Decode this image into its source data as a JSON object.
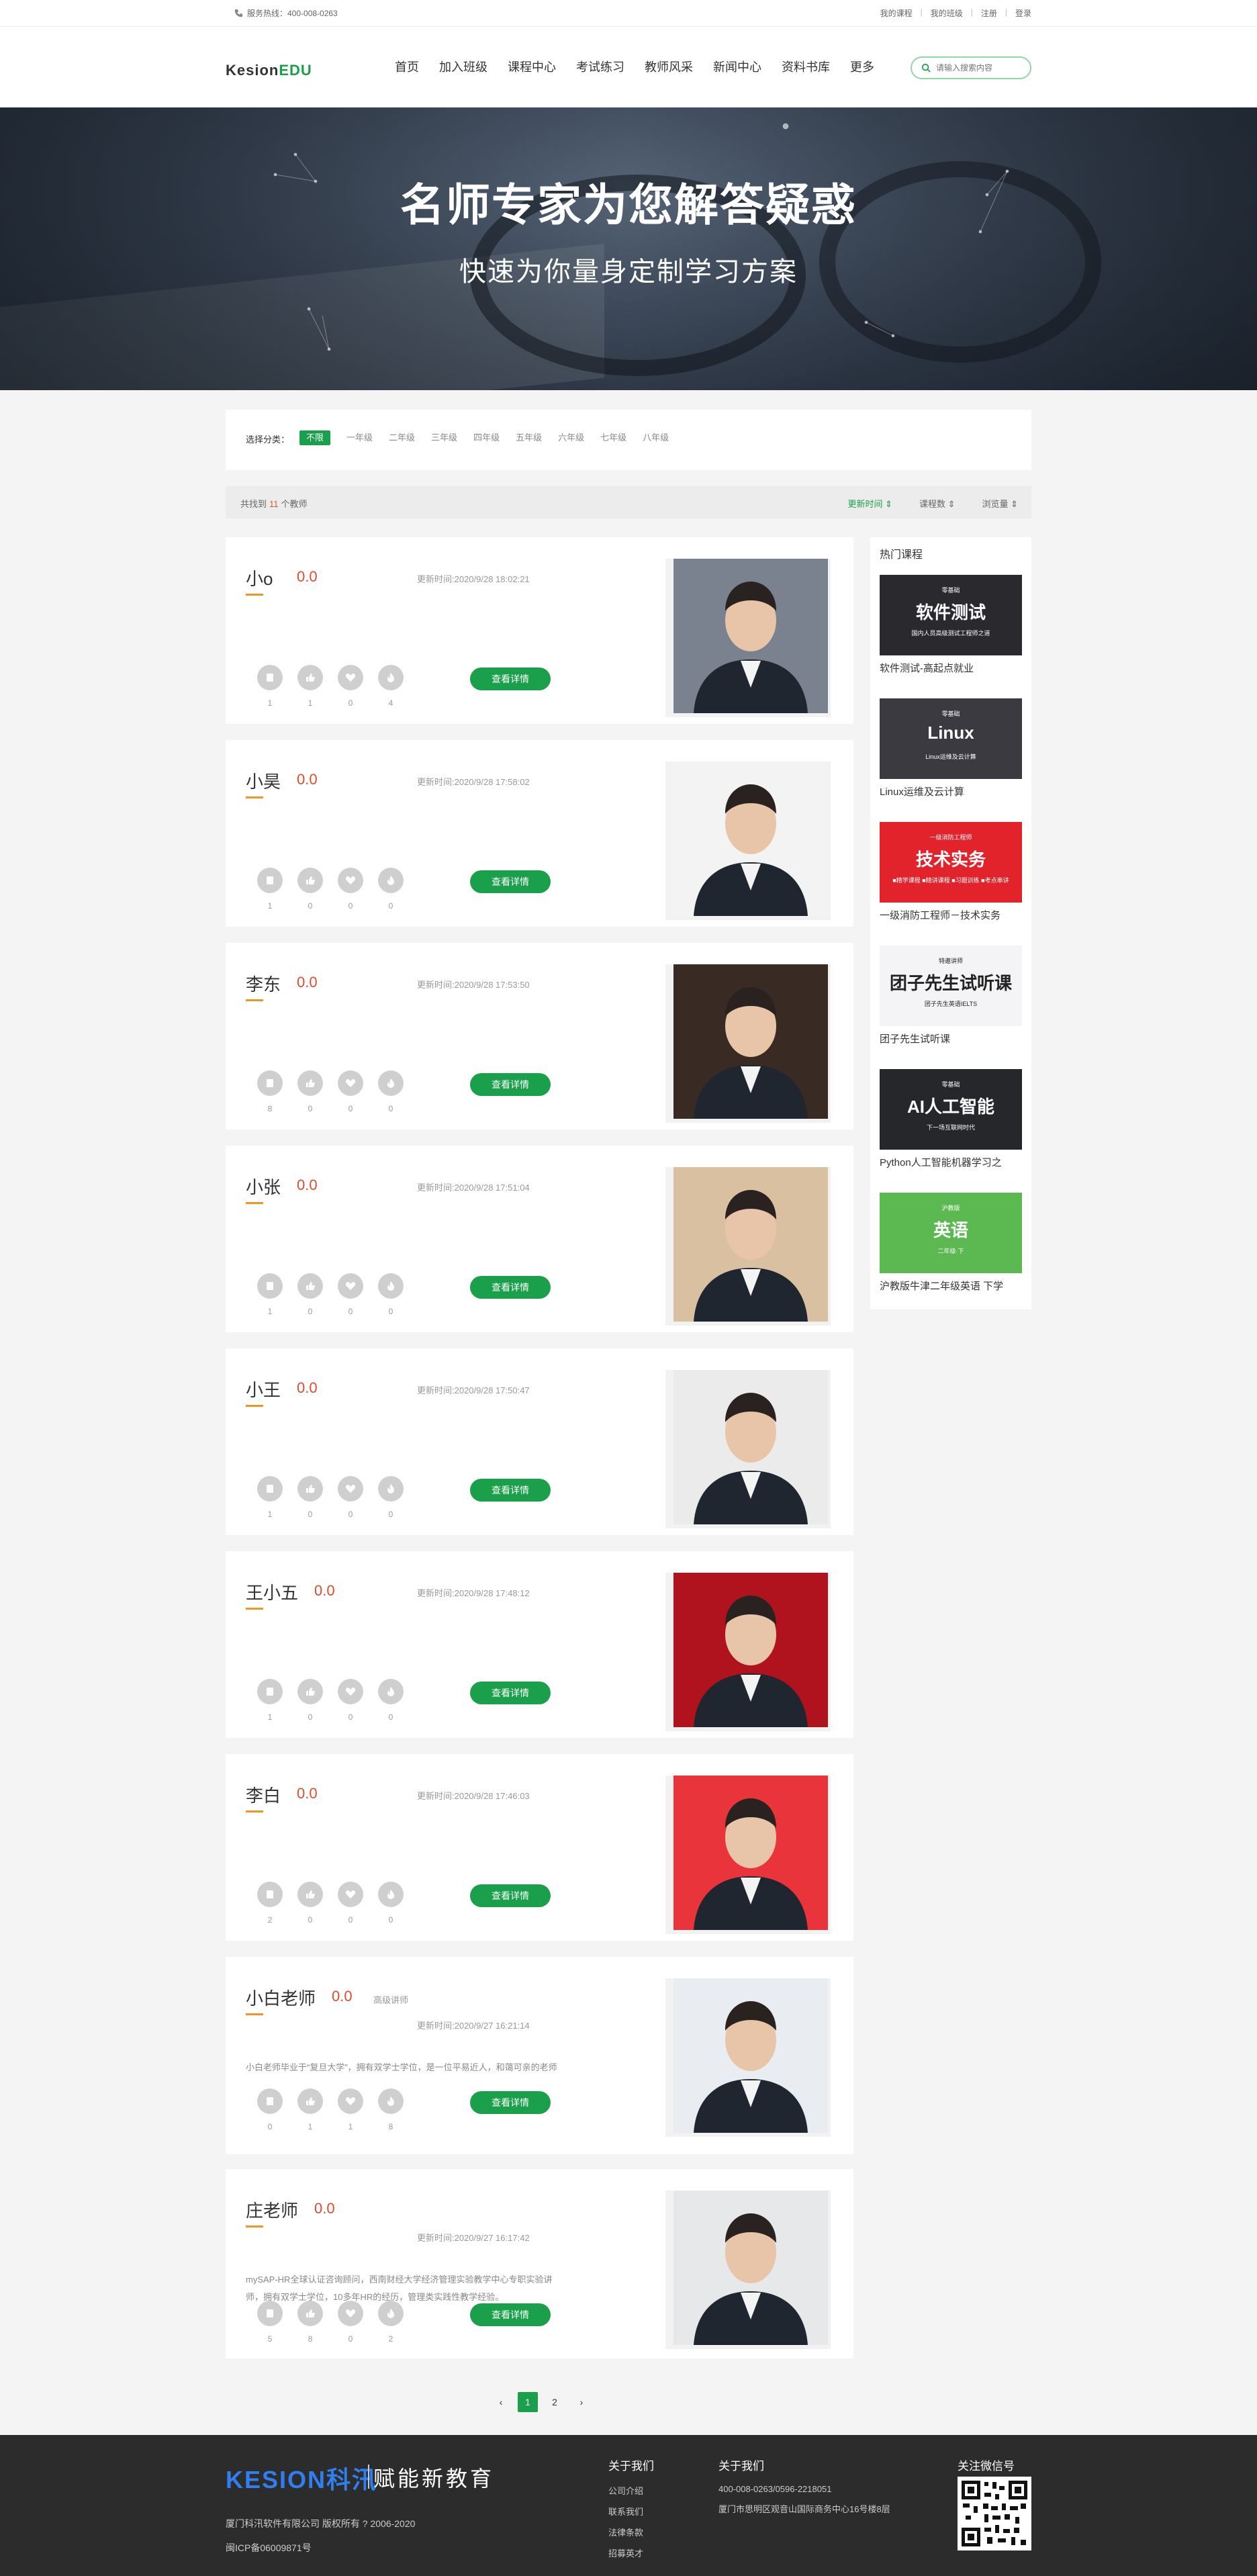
{
  "topbar": {
    "hotline": "服务热线：400-008-0263",
    "links": [
      "我的课程",
      "我的班级",
      "注册",
      "登录"
    ]
  },
  "header": {
    "logo_main": "Kesion",
    "logo_edu": "EDU",
    "nav": [
      "首页",
      "加入班级",
      "课程中心",
      "考试练习",
      "教师风采",
      "新闻中心",
      "资料书库",
      "更多"
    ],
    "search_placeholder": "请输入搜索内容"
  },
  "banner": {
    "title": "名师专家为您解答疑惑",
    "subtitle": "快速为你量身定制学习方案"
  },
  "filter": {
    "label": "选择分类：",
    "options": [
      "不限",
      "一年级",
      "二年级",
      "三年级",
      "四年级",
      "五年级",
      "六年级",
      "七年级",
      "八年级"
    ],
    "active": "不限"
  },
  "sortbar": {
    "prefix": "共找到",
    "count": "11",
    "suffix": "个教师",
    "sorts": [
      "更新时间 ⇕",
      "课程数 ⇕",
      "浏览量 ⇕"
    ]
  },
  "teachers": [
    {
      "name": "小o",
      "score": "0.0",
      "role": "",
      "time": "更新时间:2020/9/28 18:02:21",
      "intro": "",
      "stats": [
        "1",
        "1",
        "0",
        "4"
      ],
      "button": "查看详情",
      "photo_bg": "#7a8290"
    },
    {
      "name": "小昊",
      "score": "0.0",
      "role": "",
      "time": "更新时间:2020/9/28 17:58:02",
      "intro": "",
      "stats": [
        "1",
        "0",
        "0",
        "0"
      ],
      "button": "查看详情",
      "photo_bg": "#f3f3f3"
    },
    {
      "name": "李东",
      "score": "0.0",
      "role": "",
      "time": "更新时间:2020/9/28 17:53:50",
      "intro": "",
      "stats": [
        "8",
        "0",
        "0",
        "0"
      ],
      "button": "查看详情",
      "photo_bg": "#3a2a24"
    },
    {
      "name": "小张",
      "score": "0.0",
      "role": "",
      "time": "更新时间:2020/9/28 17:51:04",
      "intro": "",
      "stats": [
        "1",
        "0",
        "0",
        "0"
      ],
      "button": "查看详情",
      "photo_bg": "#d8c0a0"
    },
    {
      "name": "小王",
      "score": "0.0",
      "role": "",
      "time": "更新时间:2020/9/28 17:50:47",
      "intro": "",
      "stats": [
        "1",
        "0",
        "0",
        "0"
      ],
      "button": "查看详情",
      "photo_bg": "#ebebeb"
    },
    {
      "name": "王小五",
      "score": "0.0",
      "role": "",
      "time": "更新时间:2020/9/28 17:48:12",
      "intro": "",
      "stats": [
        "1",
        "0",
        "0",
        "0"
      ],
      "button": "查看详情",
      "photo_bg": "#b0121e"
    },
    {
      "name": "李白",
      "score": "0.0",
      "role": "",
      "time": "更新时间:2020/9/28 17:46:03",
      "intro": "",
      "stats": [
        "2",
        "0",
        "0",
        "0"
      ],
      "button": "查看详情",
      "photo_bg": "#e8343a"
    },
    {
      "name": "小白老师",
      "score": "0.0",
      "role": "高级讲师",
      "time": "更新时间:2020/9/27 16:21:14",
      "intro": "小白老师毕业于“复旦大学”，拥有双学士学位，是一位平易近人，和蔼可亲的老师",
      "stats": [
        "0",
        "1",
        "1",
        "8"
      ],
      "button": "查看详情",
      "photo_bg": "#e9ecf0"
    },
    {
      "name": "庄老师",
      "score": "0.0",
      "role": "",
      "time": "更新时间:2020/9/27 16:17:42",
      "intro": "mySAP-HR全球认证咨询顾问，西南财经大学经济管理实验教学中心专职实验讲师，拥有双学士学位，10多年HR的经历，管理类实践性教学经验。",
      "stats": [
        "5",
        "8",
        "0",
        "2"
      ],
      "button": "查看详情",
      "photo_bg": "#e6e8ea"
    }
  ],
  "sidebar": {
    "title": "热门课程",
    "courses": [
      {
        "name": "软件测试-高起点就业",
        "thumb_title": "软件测试",
        "thumb_tag": "零基础",
        "thumb_sub": "国内人员高级测试工程师之道",
        "bg": "#2a2a2e",
        "fg": "#ffffff"
      },
      {
        "name": "Linux运维及云计算",
        "thumb_title": "Linux",
        "thumb_tag": "零基础",
        "thumb_sub": "Linux运维及云计算",
        "bg": "#3a3a40",
        "fg": "#ffffff"
      },
      {
        "name": "一级消防工程师－技术实务",
        "thumb_title": "技术实务",
        "thumb_tag": "一级消防工程师",
        "thumb_sub": "■精学课程 ■精讲课程 ■习题训练 ■考点串讲",
        "bg": "#e2232b",
        "fg": "#ffffff"
      },
      {
        "name": "团子先生试听课",
        "thumb_title": "团子先生试听课",
        "thumb_tag": "特邀讲师",
        "thumb_sub": "团子先生英语IELTS",
        "bg": "#f4f4f6",
        "fg": "#222222"
      },
      {
        "name": "Python人工智能机器学习之",
        "thumb_title": "AI人工智能",
        "thumb_tag": "零基础",
        "thumb_sub": "下一场互联网时代",
        "bg": "#26272b",
        "fg": "#ffffff"
      },
      {
        "name": "沪教版牛津二年级英语 下学",
        "thumb_title": "英语",
        "thumb_tag": "沪教版",
        "thumb_sub": "二年级·下",
        "bg": "#5cb850",
        "fg": "#ffffff"
      }
    ]
  },
  "pager": {
    "prev": "‹",
    "pages": [
      "1",
      "2"
    ],
    "next": "›",
    "active": "1"
  },
  "footer": {
    "logo_en": "KESION",
    "logo_cn": "科汛",
    "slogan": "赋能新教育",
    "copyright": "厦门科汛软件有限公司 版权所有 ? 2006-2020",
    "icp": "闽ICP备06009871号",
    "about_title": "关于我们",
    "about_links": [
      "公司介绍",
      "联系我们",
      "法律条款",
      "招募英才"
    ],
    "contact_title": "关于我们",
    "contact_phone": "400-008-0263/0596-2218051",
    "contact_addr": "厦门市思明区观音山国际商务中心16号楼8层",
    "wechat_title": "关注微信号"
  },
  "colors": {
    "brand_green": "#1a9f4a",
    "score_red": "#e04c2c",
    "accent_orange": "#f09522",
    "footer_bg": "#2c2c2c"
  }
}
